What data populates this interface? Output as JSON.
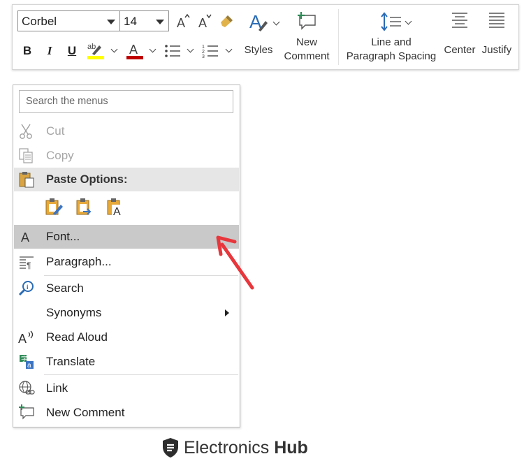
{
  "toolbar": {
    "font_name": "Corbel",
    "font_size": "14",
    "bold": "B",
    "italic": "I",
    "underline": "U",
    "styles_label": "Styles",
    "new_comment_label_1": "New",
    "new_comment_label_2": "Comment",
    "spacing_label_1": "Line and",
    "spacing_label_2": "Paragraph Spacing",
    "center_label": "Center",
    "justify_label": "Justify",
    "highlight_color": "#ffff00",
    "font_color": "#c00000"
  },
  "menu": {
    "search_placeholder": "Search the menus",
    "items": [
      {
        "label": "Cut",
        "icon": "scissors-icon",
        "disabled": true
      },
      {
        "label": "Copy",
        "icon": "copy-icon",
        "disabled": true
      },
      {
        "label": "Paste Options:",
        "icon": "clipboard-icon",
        "header": true
      },
      {
        "label": "Font...",
        "icon": "font-icon",
        "highlighted": true
      },
      {
        "label": "Paragraph...",
        "icon": "paragraph-icon"
      },
      {
        "label": "Search",
        "icon": "search-icon"
      },
      {
        "label": "Synonyms",
        "submenu": true
      },
      {
        "label": "Read Aloud",
        "icon": "read-aloud-icon"
      },
      {
        "label": "Translate",
        "icon": "translate-icon"
      },
      {
        "label": "Link",
        "icon": "link-icon"
      },
      {
        "label": "New Comment",
        "icon": "new-comment-icon"
      }
    ],
    "paste_option_icons": [
      "paste-keep-formatting-icon",
      "paste-merge-formatting-icon",
      "paste-text-only-icon"
    ]
  },
  "annotation": {
    "arrow_color": "#e8373c"
  },
  "brand": {
    "name_light": "Electronics",
    "name_bold": "Hub"
  }
}
